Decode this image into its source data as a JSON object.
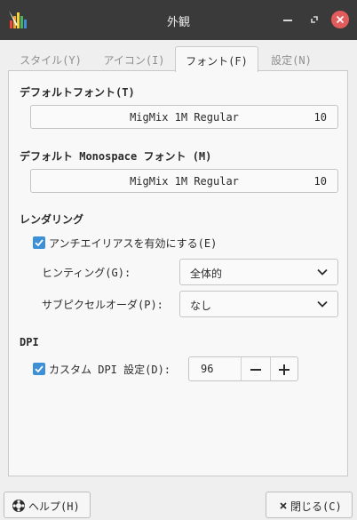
{
  "window": {
    "title": "外観"
  },
  "tabs": [
    {
      "label": "スタイル(Y)"
    },
    {
      "label": "アイコン(I)"
    },
    {
      "label": "フォント(F)"
    },
    {
      "label": "設定(N)"
    }
  ],
  "default_font": {
    "title": "デフォルトフォント(T)",
    "name": "MigMix 1M Regular",
    "size": "10"
  },
  "mono_font": {
    "title": "デフォルト Monospace フォント (M)",
    "name": "MigMix 1M Regular",
    "size": "10"
  },
  "rendering": {
    "title": "レンダリング",
    "antialias_label": "アンチエイリアスを有効にする(E)",
    "hinting_label": "ヒンティング(G):",
    "hinting_value": "全体的",
    "subpixel_label": "サブピクセルオーダ(P):",
    "subpixel_value": "なし"
  },
  "dpi": {
    "title": "DPI",
    "custom_label": "カスタム DPI 設定(D):",
    "value": "96"
  },
  "footer": {
    "help_label": "ヘルプ(H)",
    "close_label": "閉じる(C)"
  },
  "colors": {
    "accent": "#3d8fd6",
    "close_button": "#e25c5c",
    "titlebar": "#3a3a3a"
  }
}
